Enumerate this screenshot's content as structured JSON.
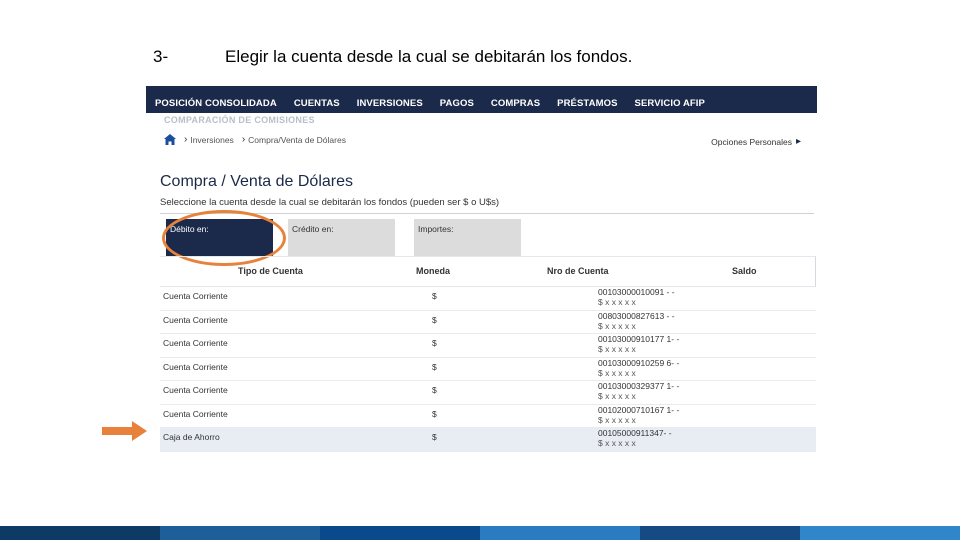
{
  "slide": {
    "step_number": "3-",
    "step_title": "Elegir la cuenta desde la cual se debitarán los fondos."
  },
  "navbar": {
    "items": [
      {
        "label": "POSICIÓN CONSOLIDADA"
      },
      {
        "label": "CUENTAS"
      },
      {
        "label": "INVERSIONES"
      },
      {
        "label": "PAGOS"
      },
      {
        "label": "COMPRAS"
      },
      {
        "label": "PRÉSTAMOS"
      },
      {
        "label": "SERVICIO AFIP"
      }
    ]
  },
  "subnav": {
    "label": "COMPARACIÓN DE COMISIONES"
  },
  "breadcrumb": {
    "items": [
      {
        "label": "Inversiones"
      },
      {
        "label": "Compra/Venta de Dólares"
      }
    ],
    "options_label": "Opciones Personales"
  },
  "page": {
    "title": "Compra / Venta de Dólares",
    "instruction": "Seleccione la cuenta desde la cual se debitarán los fondos (pueden ser $ o U$s)"
  },
  "tabs": {
    "debito": "Débito en:",
    "credito": "Crédito en:",
    "importe": "Importes:"
  },
  "table": {
    "headers": {
      "tipo": "Tipo de Cuenta",
      "moneda": "Moneda",
      "nro": "Nro de Cuenta",
      "saldo": "Saldo"
    },
    "rows": [
      {
        "tipo": "Cuenta Corriente",
        "moneda": "$",
        "nro": "00103000010091 - -",
        "saldo": "$ x x x x x"
      },
      {
        "tipo": "Cuenta Corriente",
        "moneda": "$",
        "nro": "00803000827613 - -",
        "saldo": "$ x x x x x"
      },
      {
        "tipo": "Cuenta Corriente",
        "moneda": "$",
        "nro": "00103000910177 1- -",
        "saldo": "$ x x x x x"
      },
      {
        "tipo": "Cuenta Corriente",
        "moneda": "$",
        "nro": "00103000910259 6- -",
        "saldo": "$ x x x x x"
      },
      {
        "tipo": "Cuenta Corriente",
        "moneda": "$",
        "nro": "00103000329377 1- -",
        "saldo": "$ x x x x x"
      },
      {
        "tipo": "Cuenta Corriente",
        "moneda": "$",
        "nro": "00102000710167 1- -",
        "saldo": "$ x x x x x"
      },
      {
        "tipo": "Caja de Ahorro",
        "moneda": "$",
        "nro": "00105000911347- -",
        "saldo": "$ x x x x x"
      }
    ]
  },
  "colors": {
    "navbar": "#1b2a4a",
    "highlight": "#e8823a",
    "arrow": "#e8823a",
    "footer": [
      "#0d3b66",
      "#1f5f99",
      "#0a4a8c",
      "#2b7bc0",
      "#154a82",
      "#2f86c9"
    ]
  }
}
